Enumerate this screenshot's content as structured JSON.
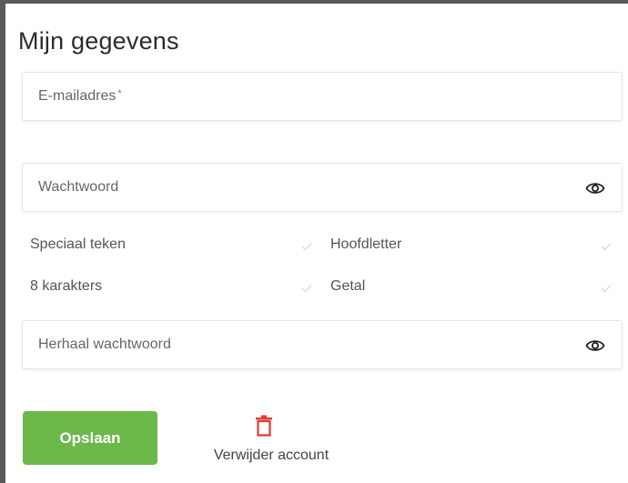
{
  "page": {
    "title": "Mijn gegevens"
  },
  "form": {
    "email": {
      "placeholder": "E-mailadres",
      "required_mark": "*"
    },
    "password": {
      "placeholder": "Wachtwoord",
      "toggle_icon": "eye-icon"
    },
    "repeat_password": {
      "placeholder": "Herhaal wachtwoord",
      "toggle_icon": "eye-icon"
    }
  },
  "password_rules": [
    {
      "label": "Speciaal teken"
    },
    {
      "label": "Hoofdletter"
    },
    {
      "label": "8 karakters"
    },
    {
      "label": "Getal"
    }
  ],
  "actions": {
    "save_label": "Opslaan",
    "delete_label": "Verwijder account",
    "delete_icon": "trash-icon"
  },
  "colors": {
    "accent_green": "#6cb84a",
    "delete_red": "#e53935",
    "check_gray": "#e0e0e0"
  }
}
